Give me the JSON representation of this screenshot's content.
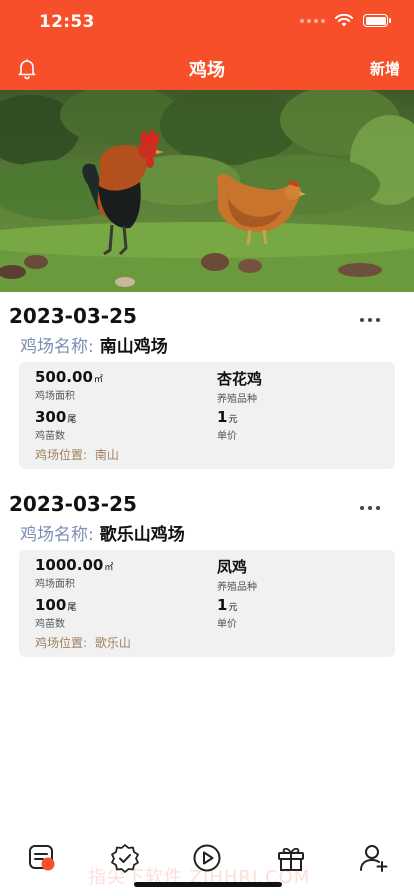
{
  "status_bar": {
    "time": "12:53"
  },
  "nav": {
    "title": "鸡场",
    "action_label": "新增"
  },
  "farms": [
    {
      "date": "2023-03-25",
      "name_label": "鸡场名称:",
      "name": "南山鸡场",
      "area_value": "500.00",
      "area_unit": "㎡",
      "area_label": "鸡场面积",
      "breed_value": "杏花鸡",
      "breed_label": "养殖品种",
      "count_value": "300",
      "count_unit": "尾",
      "count_label": "鸡苗数",
      "price_value": "1",
      "price_unit": "元",
      "price_label": "单价",
      "location_label": "鸡场位置:",
      "location": "南山"
    },
    {
      "date": "2023-03-25",
      "name_label": "鸡场名称:",
      "name": "歌乐山鸡场",
      "area_value": "1000.00",
      "area_unit": "㎡",
      "area_label": "鸡场面积",
      "breed_value": "凤鸡",
      "breed_label": "养殖品种",
      "count_value": "100",
      "count_unit": "尾",
      "count_label": "鸡苗数",
      "price_value": "1",
      "price_unit": "元",
      "price_label": "单价",
      "location_label": "鸡场位置:",
      "location": "歌乐山"
    }
  ],
  "tab_bar": {
    "tabs": [
      {
        "icon": "notes-icon"
      },
      {
        "icon": "badge-check-icon"
      },
      {
        "icon": "play-icon"
      },
      {
        "icon": "gift-icon"
      },
      {
        "icon": "add-user-icon"
      }
    ]
  },
  "watermark": "指尖下软件 ZJHHRJ.COM",
  "colors": {
    "brand": "#f64f2a",
    "label_blue": "#7d8fb3",
    "location_brown": "#a08060"
  }
}
